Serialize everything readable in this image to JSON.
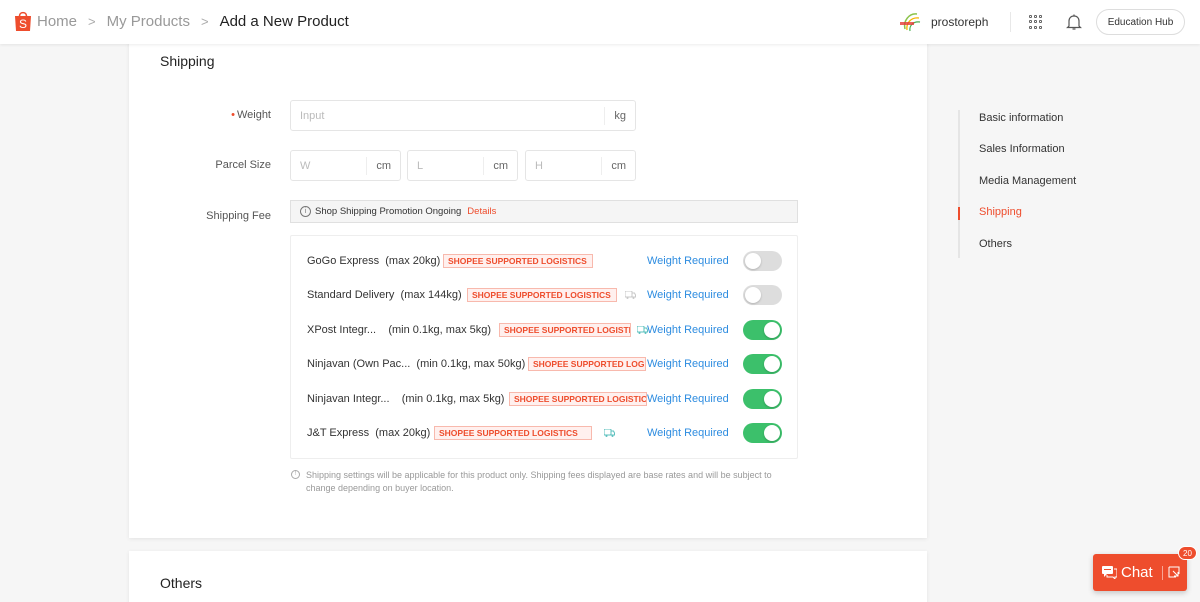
{
  "header": {
    "breadcrumbs": [
      "Home",
      "My Products",
      "Add a New Product"
    ],
    "shop_name": "prostoreph",
    "education_hub_label": "Education Hub",
    "brand_color": "#ee4d2d"
  },
  "shipping": {
    "title": "Shipping",
    "weight": {
      "label": "Weight",
      "required": true,
      "placeholder": "Input",
      "unit": "kg",
      "value": ""
    },
    "parcel_size": {
      "label": "Parcel Size",
      "fields": [
        {
          "placeholder": "W",
          "unit": "cm",
          "value": ""
        },
        {
          "placeholder": "L",
          "unit": "cm",
          "value": ""
        },
        {
          "placeholder": "H",
          "unit": "cm",
          "value": ""
        }
      ]
    },
    "shipping_fee": {
      "label": "Shipping Fee",
      "promo_text": "Shop Shipping Promotion Ongoing",
      "promo_link": "Details"
    },
    "logistics": [
      {
        "name": "GoGo Express  (max 20kg)",
        "tag": "SHOPEE SUPPORTED LOGISTICS",
        "truck_icon": "none",
        "fee": "Weight Required",
        "enabled": false
      },
      {
        "name": "Standard Delivery  (max 144kg)",
        "tag": "SHOPEE SUPPORTED LOGISTICS",
        "truck_icon": "gray",
        "fee": "Weight Required",
        "enabled": false
      },
      {
        "name": "XPost Integr...    (min 0.1kg, max 5kg)",
        "tag": "SHOPEE SUPPORTED LOGISTICS",
        "truck_icon": "teal",
        "fee": "Weight Required",
        "enabled": true
      },
      {
        "name": "Ninjavan (Own Pac...  (min 0.1kg, max 50kg)",
        "tag": "SHOPEE SUPPORTED LOGISTICS",
        "truck_icon": "none",
        "fee": "Weight Required",
        "enabled": true
      },
      {
        "name": "Ninjavan Integr...    (min 0.1kg, max 5kg)",
        "tag": "SHOPEE SUPPORTED LOGISTICS",
        "truck_icon": "none",
        "fee": "Weight Required",
        "enabled": true
      },
      {
        "name": "J&T Express  (max 20kg)",
        "tag": "SHOPEE SUPPORTED LOGISTICS",
        "truck_icon": "teal",
        "fee": "Weight Required",
        "enabled": true
      }
    ],
    "footnote": "Shipping settings will be applicable for this product only. Shipping fees displayed are base rates and will be subject to change depending on buyer location."
  },
  "others": {
    "title": "Others"
  },
  "side_nav": {
    "items": [
      "Basic information",
      "Sales Information",
      "Media Management",
      "Shipping",
      "Others"
    ],
    "active": "Shipping"
  },
  "chat": {
    "label": "Chat",
    "badge": "20"
  }
}
